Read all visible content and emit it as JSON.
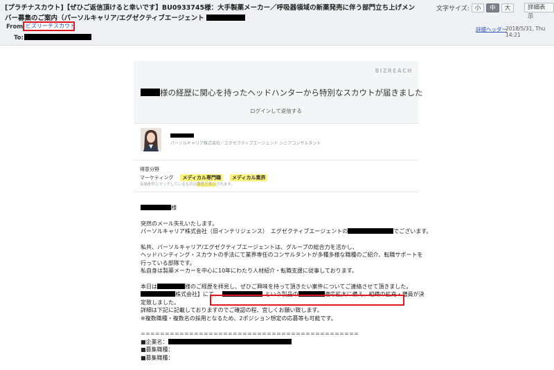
{
  "header": {
    "subject": "[プラチナスカウト]【ぜひご返信頂けると幸いです】BU0933745様：大手製薬メーカー／呼吸器領域の新薬発売に伴う部門立ち上げメンバー募集のご案内（パーソルキャリア/エグゼクティブエージェント",
    "font_size_label": "文字サイズ:",
    "font_size_small": "小",
    "font_size_medium": "中",
    "font_size_large": "大",
    "detail_display": "詳細表示",
    "from_label": "From:",
    "from_value": "ビズリーチスカウト",
    "to_label": "To:",
    "detail_header_link": "詳細ヘッダー",
    "date": "2018/5/31, Thu 14:21"
  },
  "card": {
    "logo": "BIZREACH",
    "headline": "様の経歴に関心を持ったヘッドハンターから特別なスカウトが届きました",
    "login_reply": "ログインして返信する"
  },
  "hunter": {
    "title": "パーソルキャリア株式会社／エグゼクティブエージェント シニアコンサルタント"
  },
  "specialty": {
    "label": "得意分野",
    "field": "マーケティング",
    "tags": [
      "メディカル専門職",
      "メディカル業界"
    ],
    "note_pre": "有価条件とマッチしているものは",
    "note_hl": "黄色で表示",
    "note_post": "されます。"
  },
  "letter": {
    "salutation": "様",
    "l1": "突然のメール失礼いたします。",
    "l2a": "パーソルキャリア株式会社（旧インテリジェンス）　エグゼクティブエージェントの",
    "l2b": "でございます。",
    "l3": "私共、パーソルキャリア/エグゼクティブエージェントは、グループの総合力を活かし、",
    "l4": "ヘッドハンティング・スカウトの手法にて業界専任のコンサルタントが多種多様な職種のご紹介、転職サポートを",
    "l5": "行っている部隊です。",
    "l6": "私自身は製薬メーカーを中心に10年にわたり人材紹介・転職支援に従事しております。",
    "l7a": "本日は",
    "l7b": "様のご経歴を拝見し、ぜひご興味を持って頂きたい案件についてご連絡させて頂きました。",
    "l8a": "株式会社】にて、",
    "l8b": "という製品の",
    "l8c": "適応拡大に備え、組織の拡充・増員が決",
    "l9": "定致しました。",
    "l10": "詳細は下記に記載しておりますのでご確認の程、宜しくお願い致します。",
    "l11": "※複数職種・複数名の採用となるため、2ポジション想定の応募等も可能です。",
    "separator": "=============================================",
    "company_label": "■企業名：",
    "job1_label": "■募集職種：",
    "job2_label": "■募集職種："
  }
}
